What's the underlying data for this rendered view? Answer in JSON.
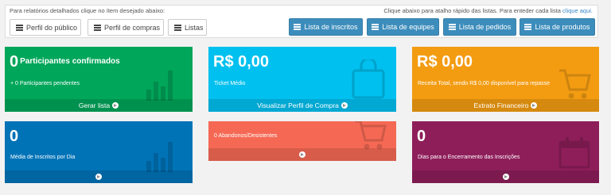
{
  "toolbar": {
    "hint_left": "Para relatórios detalhados clique no ítem desejado abaixo:",
    "hint_right_prefix": "Clique abaixo para atalho rápido das listas. Para enteder cada lista ",
    "hint_right_link": "clique aqui.",
    "report_buttons": [
      "Perfil do público",
      "Perfil de compras",
      "Listas"
    ],
    "list_buttons": [
      "Lista de inscritos",
      "Lista de equipes",
      "Lista de pedidos",
      "Lista de produtos"
    ]
  },
  "cards": {
    "participants": {
      "value": "0",
      "value_suffix": "Participantes confirmados",
      "subtitle": "+ 0 Participantes pendentes",
      "footer": "Gerar lista",
      "color": "#00a65a"
    },
    "ticket": {
      "value": "R$ 0,00",
      "subtitle": "Ticket Médio",
      "footer": "Visualizar Perfil de Compra",
      "color": "#00c0ef"
    },
    "revenue": {
      "value": "R$ 0,00",
      "subtitle": "Receita Total, sendo R$ 0,00 disponível para repasse",
      "footer": "Extrato Financeiro",
      "color": "#f39c12"
    },
    "daily": {
      "value": "0",
      "subtitle": "Média de Inscritos por Dia",
      "color": "#0073b7"
    },
    "abandon": {
      "subtitle": "0 Abandonos/Desistentes",
      "color": "#f56954"
    },
    "days": {
      "value": "0",
      "subtitle": "Dias para o Encerramento das Inscrições",
      "color": "#8e1e5a"
    }
  }
}
